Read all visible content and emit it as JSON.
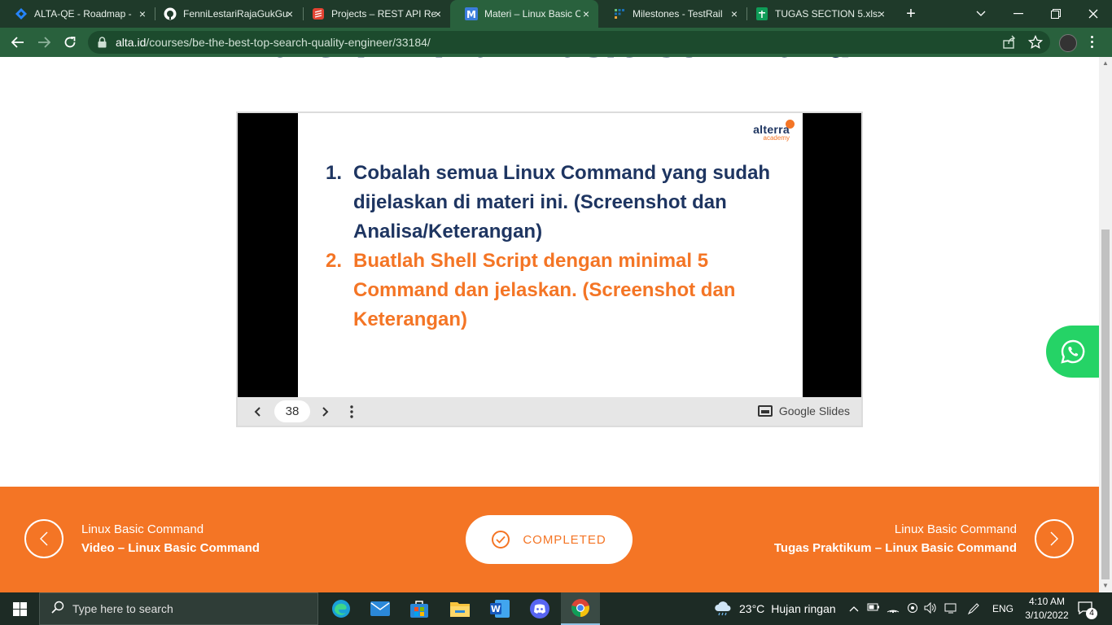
{
  "browser": {
    "tabs": [
      {
        "title": "ALTA-QE - Roadmap -",
        "icon": "jira-diamond-icon",
        "color": "#2684ff",
        "active": false
      },
      {
        "title": "FenniLestariRajaGukGu",
        "icon": "github-icon",
        "color": "#ffffff",
        "active": false
      },
      {
        "title": "Projects – REST API Re",
        "icon": "todoist-icon",
        "color": "#e44332",
        "active": false
      },
      {
        "title": "Materi – Linux Basic C",
        "icon": "alta-m-icon",
        "color": "#3b7ddd",
        "active": true
      },
      {
        "title": "Milestones - TestRail",
        "icon": "testrail-icon",
        "color": "#1a6fb3",
        "active": false
      },
      {
        "title": "TUGAS SECTION 5.xlsx",
        "icon": "sheets-icon",
        "color": "#0f9d58",
        "active": false
      }
    ],
    "url_domain": "alta.id",
    "url_path": "/courses/be-the-best-top-search-quality-engineer/33184/"
  },
  "page": {
    "title": "Materi – Linux Basic Command",
    "slide": {
      "logo_text": "alterra",
      "logo_sub": "academy",
      "items": [
        {
          "num": "1.",
          "text": "Cobalah semua Linux Command yang sudah dijelaskan di materi ini. (Screenshot dan Analisa/Keterangan)",
          "color": "#1e3561"
        },
        {
          "num": "2.",
          "text": "Buatlah Shell Script dengan minimal 5 Command dan jelaskan. (Screenshot dan Keterangan)",
          "color": "#f47525"
        }
      ],
      "page_number": "38",
      "provider": "Google Slides"
    },
    "nav": {
      "prev_label": "Linux Basic Command",
      "prev_title": "Video – Linux Basic Command",
      "completed_label": "COMPLETED",
      "next_label": "Linux Basic Command",
      "next_title": "Tugas Praktikum – Linux Basic Command"
    }
  },
  "taskbar": {
    "search_placeholder": "Type here to search",
    "weather_temp": "23°C",
    "weather_desc": "Hujan ringan",
    "language": "ENG",
    "time": "4:10 AM",
    "date": "3/10/2022",
    "notification_count": "4"
  },
  "colors": {
    "accent_orange": "#f47525",
    "navy": "#1e3561",
    "browser_green": "#29613d"
  }
}
